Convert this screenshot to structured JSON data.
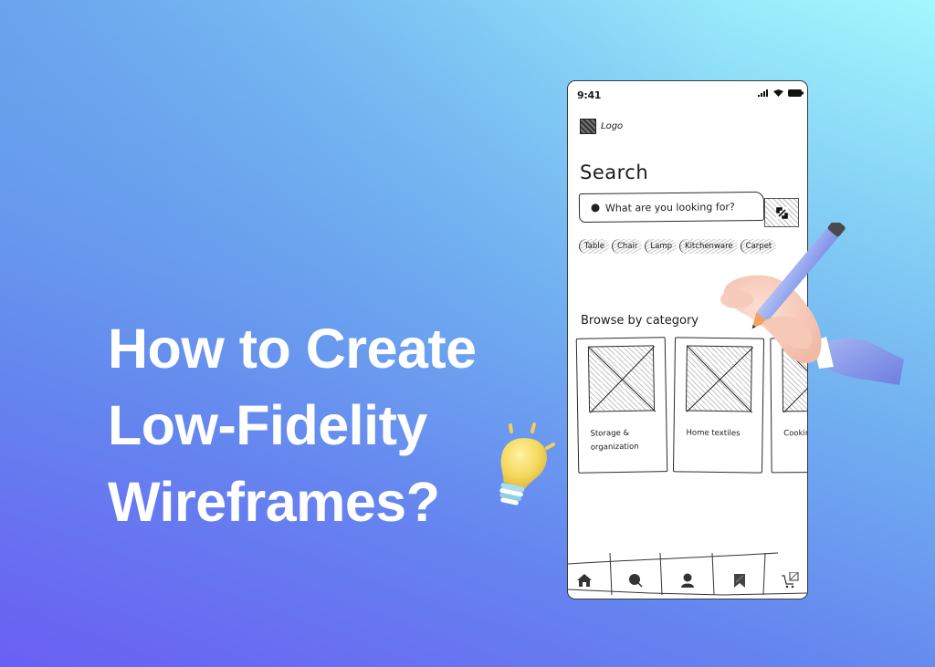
{
  "headline": {
    "lines": [
      "How to Create",
      "Low-Fidelity",
      "Wireframes?"
    ]
  },
  "decorations": {
    "bulb_icon": "lightbulb-icon",
    "hand_icon": "hand-holding-pencil-icon"
  },
  "colors": {
    "bg_top_right": "#a4f7fd",
    "bg_mid": "#70aef0",
    "bg_bottom": "#6a5ff3",
    "headline": "#ffffff",
    "bulb": "#f6dc6a",
    "pencil": "#8fa3ef",
    "sleeve": "#7f90e6"
  },
  "phone": {
    "status_bar": {
      "time": "9:41",
      "icons": [
        "signal-icon",
        "wifi-icon",
        "battery-icon"
      ]
    },
    "logo_label": "Logo",
    "search_title": "Search",
    "search_placeholder": "What are you looking for?",
    "scan_button_icon": "scan-icon",
    "chips": [
      "Table",
      "Chair",
      "Lamp",
      "Kitchenware",
      "Carpet"
    ],
    "browse_title": "Browse by category",
    "categories": [
      {
        "label": "Storage & organization"
      },
      {
        "label": "Home textiles"
      },
      {
        "label": "Cooking utensils"
      }
    ],
    "tabbar": [
      {
        "icon": "home-icon"
      },
      {
        "icon": "search-icon"
      },
      {
        "icon": "profile-icon"
      },
      {
        "icon": "bookmark-icon"
      },
      {
        "icon": "cart-icon"
      }
    ]
  }
}
